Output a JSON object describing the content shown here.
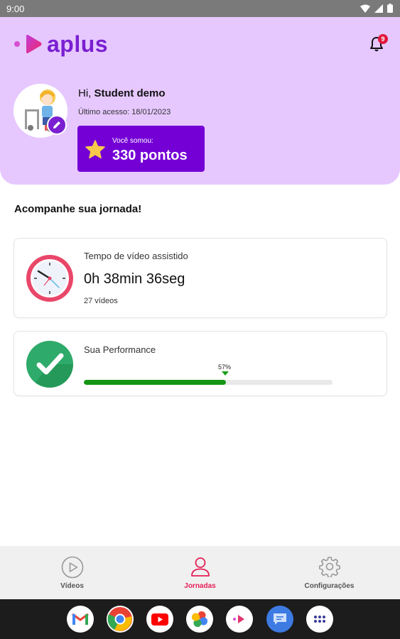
{
  "status_bar": {
    "time": "9:00"
  },
  "header": {
    "logo_text": "aplus",
    "notification_count": "9",
    "greeting_prefix": "Hi,",
    "user_name": "Student demo",
    "last_access": "Último acesso: 18/01/2023",
    "points_label": "Você somou:",
    "points_value": "330 pontos"
  },
  "main": {
    "section_title": "Acompanhe sua jornada!",
    "video_card": {
      "label": "Tempo de vídeo assistido",
      "time": "0h 38min 36seg",
      "count": "27 vídeos"
    },
    "performance_card": {
      "label": "Sua Performance",
      "percent_label": "57%",
      "progress": 0.57
    }
  },
  "bottom_nav": {
    "items": [
      {
        "label": "Vídeos",
        "icon": "play-circle-icon",
        "active": false
      },
      {
        "label": "Jornadas",
        "icon": "user-icon",
        "active": true
      },
      {
        "label": "Configurações",
        "icon": "gear-icon",
        "active": false
      }
    ]
  },
  "dock": {
    "apps": [
      "gmail-icon",
      "chrome-icon",
      "youtube-icon",
      "photos-icon",
      "aplus-app-icon",
      "messages-icon",
      "app-drawer-icon"
    ]
  },
  "colors": {
    "header_bg": "#e6c8ff",
    "brand_purple": "#7400d6",
    "active_nav": "#e61e55",
    "progress_green": "#149514"
  }
}
